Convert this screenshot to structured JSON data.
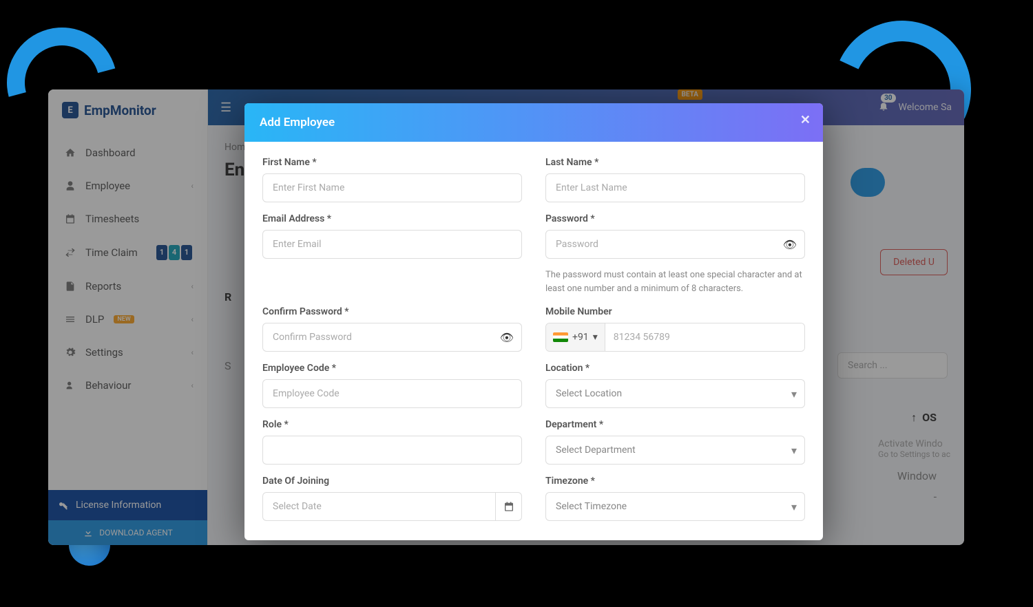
{
  "logo": {
    "text": "EmpMonitor"
  },
  "nav": {
    "dashboard": "Dashboard",
    "employee": "Employee",
    "timesheets": "Timesheets",
    "timeclaim": "Time Claim",
    "timeclaim_badge": [
      "1",
      "4",
      "1"
    ],
    "reports": "Reports",
    "dlp": "DLP",
    "dlp_badge": "NEW",
    "settings": "Settings",
    "behaviour": "Behaviour"
  },
  "sidebar_bottom": {
    "license": "License Information",
    "download": "DOWNLOAD AGENT"
  },
  "topbar": {
    "beta": "BETA",
    "notif_count": "30",
    "welcome": "Welcome  Sa"
  },
  "main": {
    "breadcrumb": "Hom",
    "title_partial": "En",
    "deleted_btn": "Deleted U",
    "search_placeholder": "Search ...",
    "os_header": "OS",
    "activate": "Activate Windo",
    "activate_sub": "Go to Settings to ac",
    "tbl_window": "Window",
    "sort_arrow": "↑",
    "r_label": "R",
    "s_label": "S",
    "dash_label": "-"
  },
  "modal": {
    "title": "Add Employee",
    "first_name_lbl": "First Name *",
    "first_name_ph": "Enter First Name",
    "last_name_lbl": "Last Name *",
    "last_name_ph": "Enter Last Name",
    "email_lbl": "Email Address *",
    "email_ph": "Enter Email",
    "password_lbl": "Password *",
    "password_ph": "Password",
    "password_help": "The password must contain at least one special character and at least one number and a minimum of 8 characters.",
    "confirm_lbl": "Confirm Password *",
    "confirm_ph": "Confirm Password",
    "mobile_lbl": "Mobile Number",
    "mobile_prefix": "+91",
    "mobile_ph": "81234 56789",
    "empcode_lbl": "Employee Code *",
    "empcode_ph": "Employee Code",
    "location_lbl": "Location *",
    "location_ph": "Select Location",
    "role_lbl": "Role *",
    "dept_lbl": "Department *",
    "dept_ph": "Select Department",
    "doj_lbl": "Date Of Joining",
    "doj_ph": "Select Date",
    "tz_lbl": "Timezone *",
    "tz_ph": "Select Timezone"
  }
}
